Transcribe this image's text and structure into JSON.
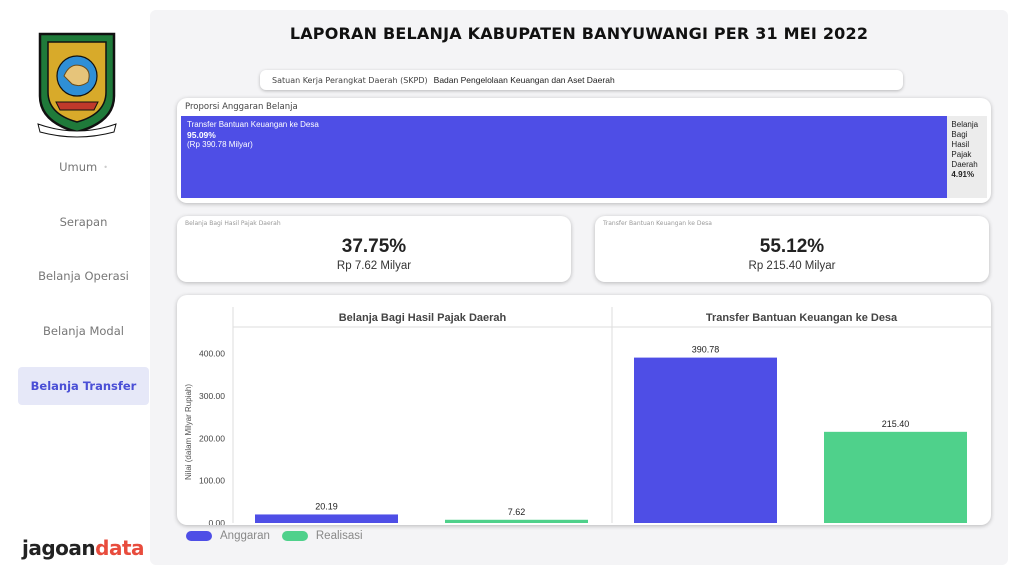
{
  "sidebar": {
    "logo_text": "BANYUWANGI",
    "logo_motto": "SATYA BHAKTI PRAJA MUKTI",
    "items": [
      {
        "label": "Umum",
        "active": false
      },
      {
        "label": "Serapan",
        "active": false
      },
      {
        "label": "Belanja Operasi",
        "active": false
      },
      {
        "label": "Belanja Modal",
        "active": false
      },
      {
        "label": "Belanja Transfer",
        "active": true
      }
    ],
    "brand_main": "jagoan",
    "brand_accent": "data"
  },
  "header": {
    "title": "LAPORAN BELANJA KABUPATEN BANYUWANGI PER 31 MEI 2022"
  },
  "skpd": {
    "label": "Satuan Kerja Perangkat Daerah (SKPD)",
    "value": "Badan Pengelolaan Keuangan dan Aset Daerah"
  },
  "proportion": {
    "title": "Proporsi Anggaran Belanja",
    "segments": [
      {
        "name": "Transfer Bantuan Keuangan ke Desa",
        "percent_label": "95.09%",
        "amount": "(Rp 390.78 Milyar)",
        "share": 0.9509,
        "color": "#4e4ee6"
      },
      {
        "name": "Belanja Bagi Hasil Pajak Daerah",
        "percent_label": "4.91%",
        "amount": "",
        "share": 0.0491,
        "color": "#ececec"
      }
    ]
  },
  "kpis": [
    {
      "label": "Belanja Bagi Hasil Pajak Daerah",
      "percent": "37.75%",
      "amount": "Rp 7.62 Milyar"
    },
    {
      "label": "Transfer Bantuan Keuangan ke Desa",
      "percent": "55.12%",
      "amount": "Rp 215.40 Milyar"
    }
  ],
  "legend": [
    {
      "label": "Anggaran",
      "color": "#4e4ee6"
    },
    {
      "label": "Realisasi",
      "color": "#4fd18b"
    }
  ],
  "chart_data": {
    "type": "bar",
    "ylabel": "Nilai (dalam Milyar Rupiah)",
    "ylim": [
      0,
      430
    ],
    "yticks": [
      0,
      100,
      200,
      300,
      400
    ],
    "ytick_labels": [
      "0.00",
      "100.00",
      "200.00",
      "300.00",
      "400.00"
    ],
    "grid": false,
    "legend_position": "bottom-left",
    "panels": [
      {
        "title": "Belanja Bagi Hasil Pajak Daerah",
        "series": [
          {
            "name": "Anggaran",
            "value": 20.19,
            "label": "20.19",
            "color": "#4e4ee6"
          },
          {
            "name": "Realisasi",
            "value": 7.62,
            "label": "7.62",
            "color": "#4fd18b"
          }
        ]
      },
      {
        "title": "Transfer Bantuan Keuangan ke Desa",
        "series": [
          {
            "name": "Anggaran",
            "value": 390.78,
            "label": "390.78",
            "color": "#4e4ee6"
          },
          {
            "name": "Realisasi",
            "value": 215.4,
            "label": "215.40",
            "color": "#4fd18b"
          }
        ]
      }
    ]
  }
}
